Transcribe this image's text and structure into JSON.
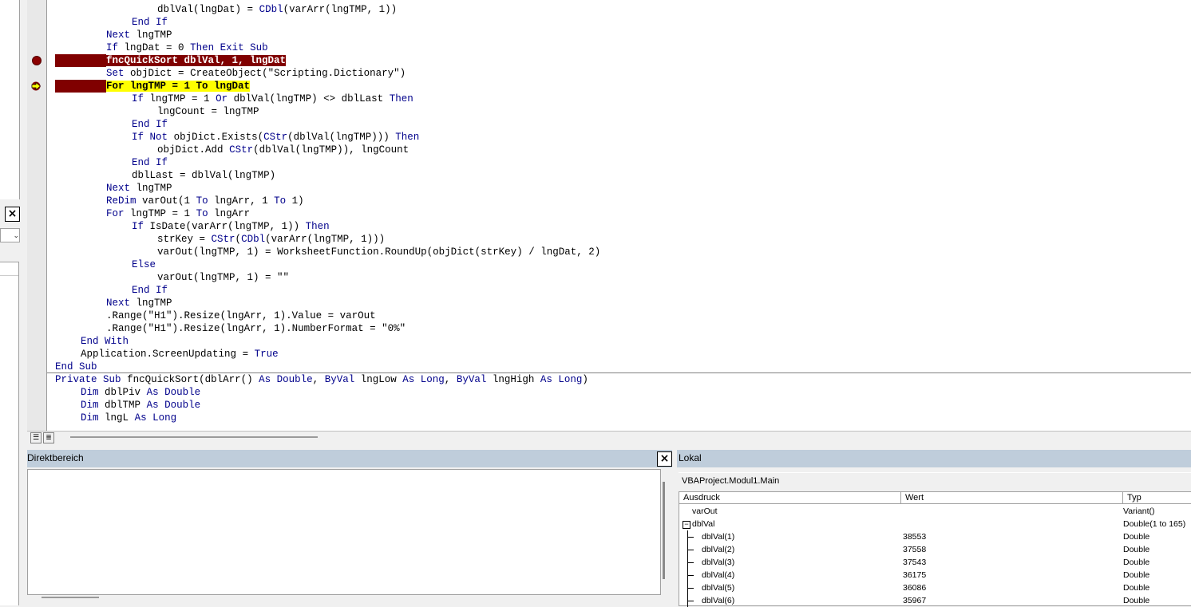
{
  "immediate_window": {
    "title": "Direktbereich",
    "close_glyph": "×"
  },
  "locals_window": {
    "title": "Lokal",
    "context": "VBAProject.Modul1.Main",
    "columns": [
      "Ausdruck",
      "Wert",
      "Typ"
    ],
    "rows": [
      {
        "expr": "varOut",
        "value": "",
        "type": "Variant()",
        "level": 0,
        "expander": ""
      },
      {
        "expr": "dblVal",
        "value": "",
        "type": "Double(1 to 165)",
        "level": 0,
        "expander": "−"
      },
      {
        "expr": "dblVal(1)",
        "value": "38553",
        "type": "Double",
        "level": 1,
        "expander": ""
      },
      {
        "expr": "dblVal(2)",
        "value": "37558",
        "type": "Double",
        "level": 1,
        "expander": ""
      },
      {
        "expr": "dblVal(3)",
        "value": "37543",
        "type": "Double",
        "level": 1,
        "expander": ""
      },
      {
        "expr": "dblVal(4)",
        "value": "36175",
        "type": "Double",
        "level": 1,
        "expander": ""
      },
      {
        "expr": "dblVal(5)",
        "value": "36086",
        "type": "Double",
        "level": 1,
        "expander": ""
      },
      {
        "expr": "dblVal(6)",
        "value": "35967",
        "type": "Double",
        "level": 1,
        "expander": ""
      }
    ]
  },
  "code": {
    "lines": [
      {
        "indent": 4,
        "text": "dblVal(lngDat) = CDbl(varArr(lngTMP, 1))"
      },
      {
        "indent": 3,
        "text": "End If"
      },
      {
        "indent": 2,
        "text": "Next lngTMP"
      },
      {
        "indent": 2,
        "text": "If lngDat = 0 Then Exit Sub"
      },
      {
        "indent": 2,
        "text": "fncQuickSort dblVal, 1, lngDat",
        "state": "breakpoint"
      },
      {
        "indent": 2,
        "text": "Set objDict = CreateObject(\"Scripting.Dictionary\")"
      },
      {
        "indent": 2,
        "text": "For lngTMP = 1 To lngDat",
        "state": "current"
      },
      {
        "indent": 3,
        "text": "If lngTMP = 1 Or dblVal(lngTMP) <> dblLast Then"
      },
      {
        "indent": 4,
        "text": "lngCount = lngTMP"
      },
      {
        "indent": 3,
        "text": "End If"
      },
      {
        "indent": 3,
        "text": "If Not objDict.Exists(CStr(dblVal(lngTMP))) Then"
      },
      {
        "indent": 4,
        "text": "objDict.Add CStr(dblVal(lngTMP)), lngCount"
      },
      {
        "indent": 3,
        "text": "End If"
      },
      {
        "indent": 3,
        "text": "dblLast = dblVal(lngTMP)"
      },
      {
        "indent": 2,
        "text": "Next lngTMP"
      },
      {
        "indent": 2,
        "text": "ReDim varOut(1 To lngArr, 1 To 1)"
      },
      {
        "indent": 2,
        "text": "For lngTMP = 1 To lngArr"
      },
      {
        "indent": 3,
        "text": "If IsDate(varArr(lngTMP, 1)) Then"
      },
      {
        "indent": 4,
        "text": "strKey = CStr(CDbl(varArr(lngTMP, 1)))"
      },
      {
        "indent": 4,
        "text": "varOut(lngTMP, 1) = WorksheetFunction.RoundUp(objDict(strKey) / lngDat, 2)"
      },
      {
        "indent": 3,
        "text": "Else"
      },
      {
        "indent": 4,
        "text": "varOut(lngTMP, 1) = \"\""
      },
      {
        "indent": 3,
        "text": "End If"
      },
      {
        "indent": 2,
        "text": "Next lngTMP"
      },
      {
        "indent": 2,
        "text": ".Range(\"H1\").Resize(lngArr, 1).Value = varOut"
      },
      {
        "indent": 2,
        "text": ".Range(\"H1\").Resize(lngArr, 1).NumberFormat = \"0%\""
      },
      {
        "indent": 1,
        "text": "End With"
      },
      {
        "indent": 1,
        "text": "Application.ScreenUpdating = True"
      },
      {
        "indent": 0,
        "text": "End Sub"
      },
      {
        "indent": 0,
        "text": "Private Sub fncQuickSort(dblArr() As Double, ByVal lngLow As Long, ByVal lngHigh As Long)"
      },
      {
        "indent": 1,
        "text": "Dim dblPiv As Double"
      },
      {
        "indent": 1,
        "text": "Dim dblTMP As Double"
      },
      {
        "indent": 1,
        "text": "Dim lngL As Long"
      }
    ]
  },
  "icons": {
    "breakpoint": "breakpoint-icon",
    "current_line": "execution-arrow-icon",
    "procedure_view": "procedure-view-icon",
    "full_module_view": "full-module-view-icon"
  },
  "colors": {
    "breakpoint": "#800000",
    "current_line": "#ffff00",
    "keyword": "#00008b",
    "panel_title": "#bfcddb"
  }
}
